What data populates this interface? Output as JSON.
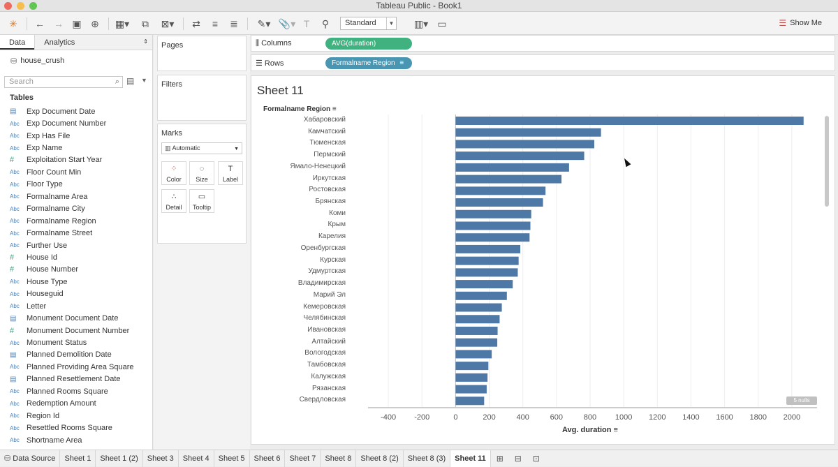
{
  "window": {
    "title": "Tableau Public - Book1"
  },
  "toolbar": {
    "view_mode": "Standard",
    "show_me_label": "Show Me"
  },
  "left_pane": {
    "tabs": [
      "Data",
      "Analytics"
    ],
    "datasource": "house_crush",
    "search_placeholder": "Search",
    "tables_heading": "Tables",
    "fields": [
      {
        "name": "Exp Document Date",
        "type": "date"
      },
      {
        "name": "Exp Document Number",
        "type": "string"
      },
      {
        "name": "Exp Has File",
        "type": "string"
      },
      {
        "name": "Exp Name",
        "type": "string"
      },
      {
        "name": "Exploitation Start Year",
        "type": "number"
      },
      {
        "name": "Floor Count Min",
        "type": "string"
      },
      {
        "name": "Floor Type",
        "type": "string"
      },
      {
        "name": "Formalname Area",
        "type": "string"
      },
      {
        "name": "Formalname City",
        "type": "string"
      },
      {
        "name": "Formalname Region",
        "type": "string"
      },
      {
        "name": "Formalname Street",
        "type": "string"
      },
      {
        "name": "Further Use",
        "type": "string"
      },
      {
        "name": "House Id",
        "type": "number"
      },
      {
        "name": "House Number",
        "type": "number"
      },
      {
        "name": "House Type",
        "type": "string"
      },
      {
        "name": "Houseguid",
        "type": "string"
      },
      {
        "name": "Letter",
        "type": "string"
      },
      {
        "name": "Monument Document Date",
        "type": "date"
      },
      {
        "name": "Monument Document Number",
        "type": "number"
      },
      {
        "name": "Monument Status",
        "type": "string"
      },
      {
        "name": "Planned Demolition Date",
        "type": "date"
      },
      {
        "name": "Planned Providing Area Square",
        "type": "string"
      },
      {
        "name": "Planned Resettlement Date",
        "type": "date"
      },
      {
        "name": "Planned Rooms Square",
        "type": "string"
      },
      {
        "name": "Redemption Amount",
        "type": "string"
      },
      {
        "name": "Region Id",
        "type": "string"
      },
      {
        "name": "Resettled Rooms Square",
        "type": "string"
      },
      {
        "name": "Shortname Area",
        "type": "string"
      }
    ]
  },
  "cards": {
    "pages_title": "Pages",
    "filters_title": "Filters",
    "marks_title": "Marks",
    "marks_type": "Automatic",
    "mark_buttons": [
      "Color",
      "Size",
      "Label",
      "Detail",
      "Tooltip"
    ]
  },
  "shelves": {
    "columns_label": "Columns",
    "columns_pill": "AVG(duration)",
    "rows_label": "Rows",
    "rows_pill": "Formalname Region"
  },
  "sheet": {
    "title": "Sheet 11",
    "row_header": "Formalname Region",
    "x_axis_label": "Avg. duration",
    "nulls_badge": "5 nulls"
  },
  "chart_data": {
    "type": "bar",
    "orientation": "horizontal",
    "categories": [
      "Хабаровский",
      "Камчатский",
      "Тюменская",
      "Пермский",
      "Ямало-Ненецкий",
      "Иркутская",
      "Ростовская",
      "Брянская",
      "Коми",
      "Крым",
      "Карелия",
      "Оренбургская",
      "Курская",
      "Удмуртская",
      "Владимирская",
      "Марий Эл",
      "Кемеровская",
      "Челябинская",
      "Ивановская",
      "Алтайский",
      "Вологодская",
      "Тамбовская",
      "Калужская",
      "Рязанская",
      "Свердловская"
    ],
    "values": [
      2070,
      865,
      825,
      765,
      675,
      630,
      535,
      520,
      450,
      445,
      440,
      385,
      375,
      370,
      340,
      305,
      275,
      262,
      250,
      248,
      215,
      195,
      190,
      185,
      170
    ],
    "xlabel": "Avg. duration",
    "ylabel": "Formalname Region",
    "xlim": [
      -500,
      2150
    ],
    "xticks": [
      -400,
      -200,
      0,
      200,
      400,
      600,
      800,
      1000,
      1200,
      1400,
      1600,
      1800,
      2000
    ],
    "bar_color": "#4e79a7",
    "grid": true
  },
  "bottom_tabs": {
    "data_source": "Data Source",
    "sheets": [
      "Sheet 1",
      "Sheet 1 (2)",
      "Sheet 3",
      "Sheet 4",
      "Sheet 5",
      "Sheet 6",
      "Sheet 7",
      "Sheet 8",
      "Sheet 8 (2)",
      "Sheet 8 (3)",
      "Sheet 11"
    ],
    "active": "Sheet 11"
  },
  "colors": {
    "pill_measure": "#3fb27f",
    "pill_dimension": "#4996b2",
    "bar": "#4e79a7"
  }
}
